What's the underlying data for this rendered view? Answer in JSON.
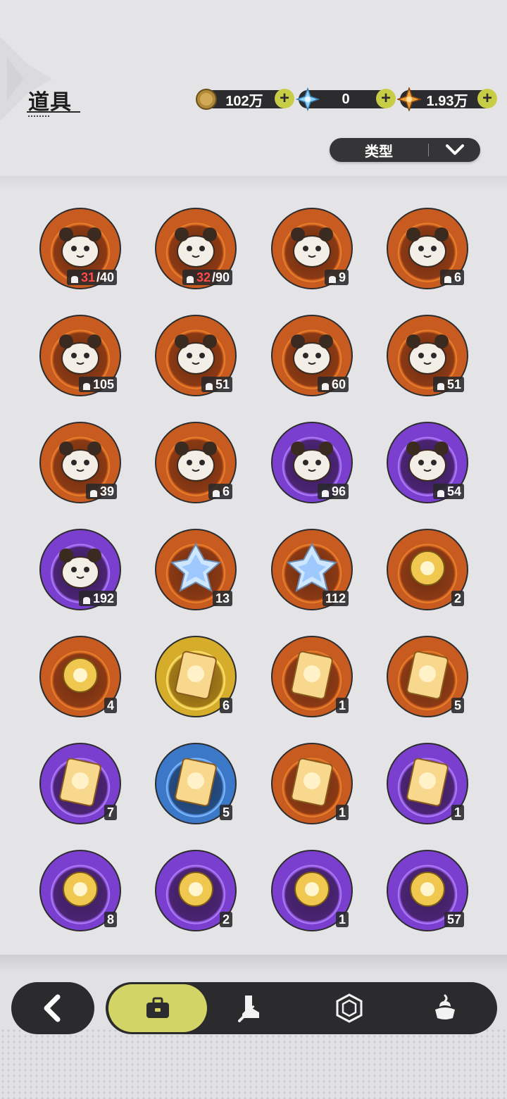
{
  "page": {
    "title": "道具"
  },
  "currencies": [
    {
      "icon": "gold-coin-icon",
      "value": "102万"
    },
    {
      "icon": "snow-crystal-icon",
      "value": "0"
    },
    {
      "icon": "amber-star-icon",
      "value": "1.93万"
    }
  ],
  "filter": {
    "label": "类型"
  },
  "items": [
    {
      "icon": "mystery-plush-orange-icon",
      "tier": "orange",
      "count_have": "31",
      "count_need": "/40"
    },
    {
      "icon": "mystery-plush-gold-icon",
      "tier": "orange",
      "count_have": "32",
      "count_need": "/90"
    },
    {
      "icon": "teal-bird-plush-icon",
      "tier": "orange",
      "count": "9"
    },
    {
      "icon": "red-fox-plush-icon",
      "tier": "orange",
      "count": "6"
    },
    {
      "icon": "brown-bear-plush-icon",
      "tier": "orange",
      "count": "105"
    },
    {
      "icon": "knight-plush-icon",
      "tier": "orange",
      "count": "51"
    },
    {
      "icon": "white-cat-plush-icon",
      "tier": "orange",
      "count": "60"
    },
    {
      "icon": "white-bunny-plush-icon",
      "tier": "orange",
      "count": "51"
    },
    {
      "icon": "dark-bear-plush-icon",
      "tier": "orange",
      "count": "39"
    },
    {
      "icon": "lilac-bunny-plush-icon",
      "tier": "orange",
      "count": "6"
    },
    {
      "icon": "leaf-plush-icon",
      "tier": "purple",
      "count": "96"
    },
    {
      "icon": "eyepatch-bear-plush-icon",
      "tier": "purple",
      "count": "54"
    },
    {
      "icon": "yellow-chick-plush-icon",
      "tier": "purple",
      "count": "192"
    },
    {
      "icon": "pink-crystal-icon",
      "tier": "orange",
      "count": "13"
    },
    {
      "icon": "blue-crystal-icon",
      "tier": "orange",
      "count": "112"
    },
    {
      "icon": "red-paw-charm-icon",
      "tier": "orange",
      "count": "2"
    },
    {
      "icon": "gold-paw-charm-icon",
      "tier": "orange",
      "count": "4"
    },
    {
      "icon": "golden-card-icon",
      "tier": "gold",
      "count": "6"
    },
    {
      "icon": "rainbow-card-icon",
      "tier": "orange",
      "count": "1"
    },
    {
      "icon": "orange-card-icon",
      "tier": "orange",
      "count": "5"
    },
    {
      "icon": "purple-card-icon",
      "tier": "purple",
      "count": "7"
    },
    {
      "icon": "blue-card-icon",
      "tier": "blue",
      "count": "5"
    },
    {
      "icon": "spiral-book-icon",
      "tier": "orange",
      "count": "1"
    },
    {
      "icon": "gift-box-icon",
      "tier": "purple",
      "count": "1"
    },
    {
      "icon": "gold-pouch-icon",
      "tier": "purple",
      "count": "8"
    },
    {
      "icon": "magic-mirror-icon",
      "tier": "purple",
      "count": "2"
    },
    {
      "icon": "scroll-icon",
      "tier": "purple",
      "count": "1"
    },
    {
      "icon": "pink-apple-icon",
      "tier": "purple",
      "count": "57"
    }
  ],
  "nav": {
    "back": "back-arrow-icon",
    "tabs": [
      "bag-icon",
      "boot-sword-icon",
      "gem-icon",
      "dessert-icon"
    ],
    "active": 0
  },
  "colors": {
    "bg": "#e4e4e6",
    "dark": "#2c2c2e",
    "accent": "#c8cd46"
  }
}
